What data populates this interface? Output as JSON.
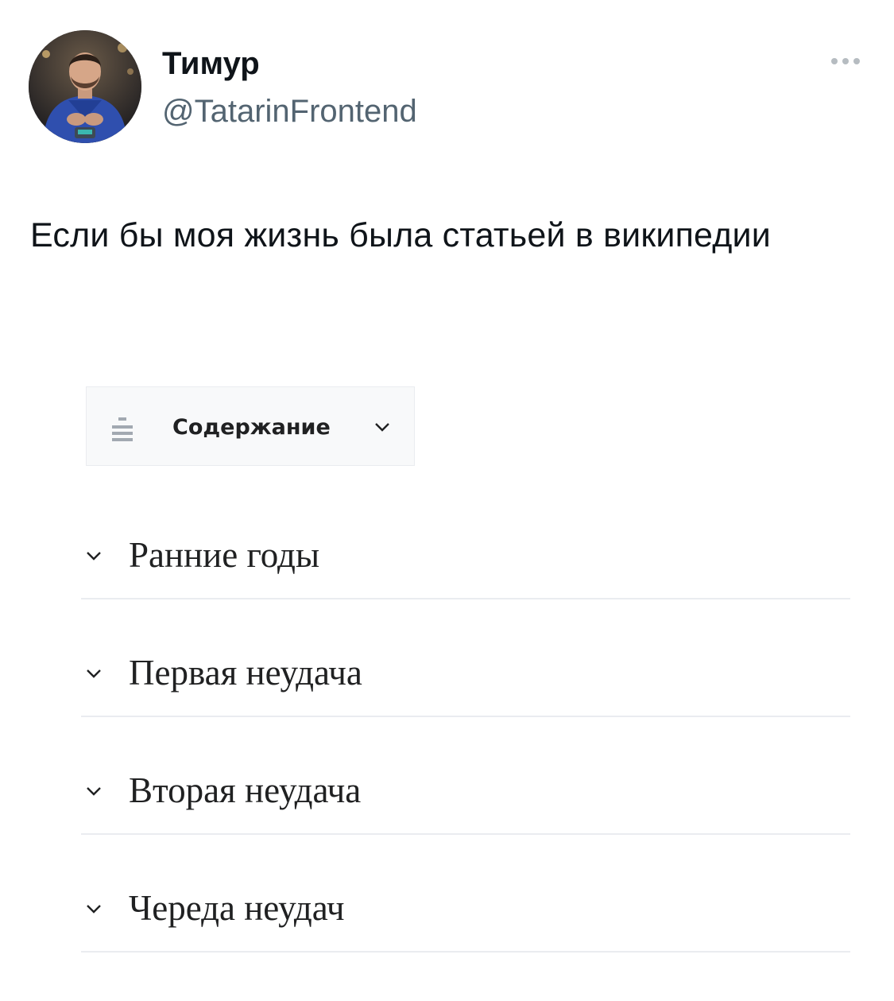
{
  "tweet": {
    "author_name": "Тимур",
    "author_handle": "@TatarinFrontend",
    "text": "Если бы моя жизнь была статьей в википедии"
  },
  "icons": {
    "more": "more-horizontal-icon",
    "avatar": "user-avatar",
    "toc": "list-icon",
    "chevron": "chevron-down-icon"
  },
  "colors": {
    "text": "#0f1419",
    "secondary_text": "#536471",
    "wiki_text": "#202122",
    "wiki_border": "#eaecf0",
    "toc_background": "#f8f9fa"
  },
  "wiki": {
    "toc_label": "Содержание",
    "sections": [
      {
        "label": "Ранние годы"
      },
      {
        "label": "Первая неудача"
      },
      {
        "label": "Вторая неудача"
      },
      {
        "label": "Череда неудач"
      }
    ]
  }
}
